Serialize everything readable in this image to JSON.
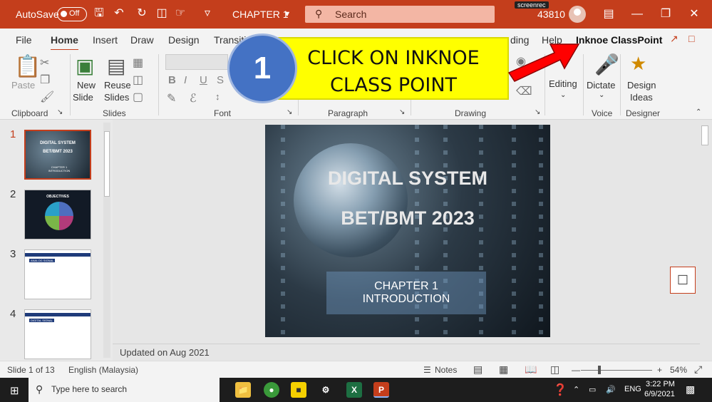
{
  "titlebar": {
    "autosave_label": "AutoSave",
    "autosave_state": "Off",
    "document_title": "CHAPTER 1",
    "search_placeholder": "Search",
    "screenrec_label": "screenrec",
    "user_id": "43810"
  },
  "tabs": [
    {
      "label": "File"
    },
    {
      "label": "Home"
    },
    {
      "label": "Insert"
    },
    {
      "label": "Draw"
    },
    {
      "label": "Design"
    },
    {
      "label": "Transiti"
    },
    {
      "label": "ding"
    },
    {
      "label": "Help"
    },
    {
      "label": "Inknoe ClassPoint"
    }
  ],
  "ribbon": {
    "groups": [
      "Clipboard",
      "Slides",
      "Font",
      "Paragraph",
      "Drawing",
      "Voice",
      "Designer"
    ],
    "paste_label": "Paste",
    "new_slide_1": "New",
    "new_slide_2": "Slide",
    "reuse_slides_1": "Reuse",
    "reuse_slides_2": "Slides",
    "editing_label": "Editing",
    "dictate_label": "Dictate",
    "design_ideas_1": "Design",
    "design_ideas_2": "Ideas",
    "font_buttons": [
      "B",
      "I",
      "U",
      "S"
    ]
  },
  "callout": {
    "step_number": "1",
    "line1": "CLICK ON INKNOE",
    "line2": "CLASS POINT",
    "accent_color": "#ffff00",
    "arrow_color": "#ff0000"
  },
  "slide_thumbnails": [
    {
      "number": "1",
      "title": "DIGITAL SYSTEM",
      "subtitle": "BET/BMT 2023",
      "caption": "CHAPTER 1 INTRODUCTION"
    },
    {
      "number": "2",
      "title": "OBJECTIVES"
    },
    {
      "number": "3",
      "title": "ANALOG SIGNAL"
    },
    {
      "number": "4",
      "title": "DIGITAL SIGNAL"
    }
  ],
  "slide": {
    "title_line1": "DIGITAL SYSTEM",
    "title_line2": "BET/BMT 2023",
    "caption_line1": "CHAPTER 1",
    "caption_line2": "INTRODUCTION"
  },
  "notes_text": "Updated on Aug 2021",
  "statusbar": {
    "slide_count": "Slide 1 of 13",
    "language": "English (Malaysia)",
    "notes_label": "Notes",
    "zoom_level": "54%"
  },
  "taskbar": {
    "search_placeholder": "Type here to search",
    "language": "ENG",
    "time": "3:22 PM",
    "date": "6/9/2021"
  },
  "colors": {
    "brand": "#c43e1c"
  }
}
